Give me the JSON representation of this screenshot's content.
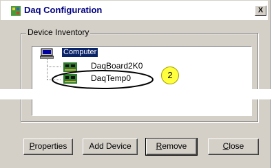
{
  "window": {
    "title": "Daq Configuration",
    "close_glyph": "X"
  },
  "group": {
    "label": "Device Inventory"
  },
  "tree": {
    "root": "Computer",
    "children": [
      "DaqBoard2K0",
      "DaqTemp0"
    ]
  },
  "callout": {
    "number": "2"
  },
  "buttons": {
    "properties": {
      "accel": "P",
      "rest": "roperties"
    },
    "add_device": {
      "label": "Add Device"
    },
    "remove": {
      "accel": "R",
      "rest": "emove"
    },
    "close": {
      "accel": "C",
      "rest": "lose"
    }
  },
  "colors": {
    "title_text": "#000080",
    "selection": "#0a246a",
    "callout_fill": "#ffff40"
  }
}
